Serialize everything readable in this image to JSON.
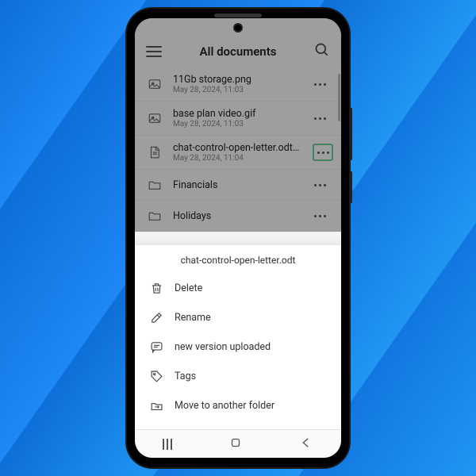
{
  "header": {
    "title": "All documents"
  },
  "files": [
    {
      "name": "11Gb storage.png",
      "date": "May 28, 2024, 11:03",
      "type": "image"
    },
    {
      "name": "base plan video.gif",
      "date": "May 28, 2024, 11:03",
      "type": "image"
    },
    {
      "name": "chat-control-open-letter.odt",
      "date": "May 28, 2024, 11:04",
      "type": "doc",
      "badges": true,
      "highlight": true
    },
    {
      "name": "Financials",
      "date": "",
      "type": "folder"
    },
    {
      "name": "Holidays",
      "date": "",
      "type": "folder"
    }
  ],
  "sheet": {
    "title": "chat-control-open-letter.odt",
    "items": {
      "delete": "Delete",
      "rename": "Rename",
      "version": "new version uploaded",
      "tags": "Tags",
      "move": "Move to another folder"
    }
  }
}
